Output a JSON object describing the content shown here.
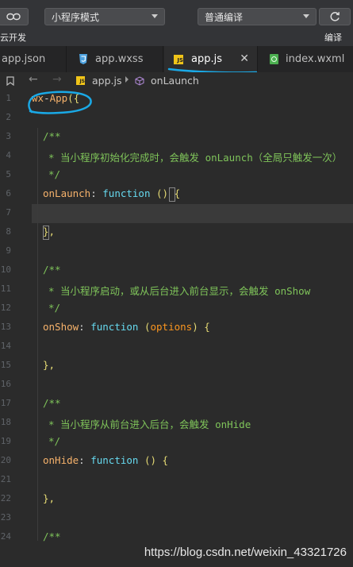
{
  "toolbar": {
    "cloud_label": "云开发",
    "mode_select": "小程序模式",
    "compile_select": "普通编译",
    "compile_label": "编译"
  },
  "tabs": [
    {
      "label": "app.json",
      "icon": "json-icon"
    },
    {
      "label": "app.wxss",
      "icon": "css-icon",
      "icon_color": "#4ea3e0"
    },
    {
      "label": "app.js",
      "icon": "js-icon",
      "icon_color": "#f0c419",
      "active": true
    },
    {
      "label": "index.wxml",
      "icon": "wxml-icon",
      "icon_color": "#4caf50"
    }
  ],
  "breadcrumb": {
    "file": "app.js",
    "symbol": "onLaunch"
  },
  "code": {
    "lines": [
      {
        "n": "1",
        "text": ""
      },
      {
        "n": "2",
        "text": ""
      },
      {
        "n": "3",
        "text": ""
      },
      {
        "n": "4",
        "text": ""
      },
      {
        "n": "5",
        "text": ""
      },
      {
        "n": "6",
        "text": ""
      },
      {
        "n": "7",
        "text": ""
      },
      {
        "n": "8",
        "text": ""
      },
      {
        "n": "9",
        "text": ""
      },
      {
        "n": "10",
        "text": ""
      },
      {
        "n": "11",
        "text": ""
      },
      {
        "n": "12",
        "text": ""
      },
      {
        "n": "13",
        "text": ""
      },
      {
        "n": "14",
        "text": ""
      },
      {
        "n": "15",
        "text": ""
      },
      {
        "n": "16",
        "text": ""
      },
      {
        "n": "17",
        "text": ""
      },
      {
        "n": "18",
        "text": ""
      },
      {
        "n": "19",
        "text": ""
      },
      {
        "n": "20",
        "text": ""
      },
      {
        "n": "21",
        "text": ""
      },
      {
        "n": "22",
        "text": ""
      },
      {
        "n": "23",
        "text": ""
      },
      {
        "n": "24",
        "text": ""
      }
    ],
    "tokens": {
      "l1_wx": "wx",
      "l1_dash": "-",
      "l1_app": "App",
      "l1_open": "({",
      "c_open": "/**",
      "c_close": "*/",
      "l4_comment": "* 当小程序初始化完成时，会触发 onLaunch（全局只触发一次）",
      "l6_name": "onLaunch",
      "colon": ":",
      "kw_function": "function",
      "l6_args": "() {",
      "l8_close": "},",
      "l11_comment": "* 当小程序启动，或从后台进入前台显示，会触发 onShow",
      "l13_name": "onShow",
      "l13_open": "(",
      "l13_param": "options",
      "l13_close": ") {",
      "l15_close": "},",
      "l18_comment": "* 当小程序从前台进入后台，会触发 onHide",
      "l20_name": "onHide",
      "l20_args": "() {",
      "l22_close": "},",
      "l24_partial": "/**"
    }
  },
  "watermark": "https://blog.csdn.net/weixin_43321726"
}
